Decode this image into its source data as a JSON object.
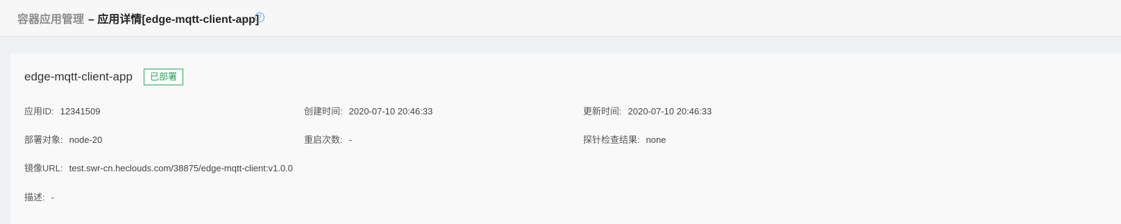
{
  "header": {
    "parent": "容器应用管理",
    "current": "– 应用详情[edge-mqtt-client-app]",
    "help_icon": "question-circle-icon"
  },
  "app": {
    "name": "edge-mqtt-client-app",
    "status": "已部署",
    "status_color": "#25a55a"
  },
  "details": {
    "app_id": {
      "label": "应用ID:",
      "value": "12341509"
    },
    "created": {
      "label": "创建时间:",
      "value": "2020-07-10 20:46:33"
    },
    "updated": {
      "label": "更新时间:",
      "value": "2020-07-10 20:46:33"
    },
    "target": {
      "label": "部署对象:",
      "value": "node-20"
    },
    "restarts": {
      "label": "重启次数:",
      "value": "-"
    },
    "probe": {
      "label": "探针检查结果:",
      "value": "none"
    },
    "image": {
      "label": "镜像URL:",
      "value": "test.swr-cn.heclouds.com/38875/edge-mqtt-client:v1.0.0"
    },
    "desc": {
      "label": "描述:",
      "value": "-"
    }
  }
}
